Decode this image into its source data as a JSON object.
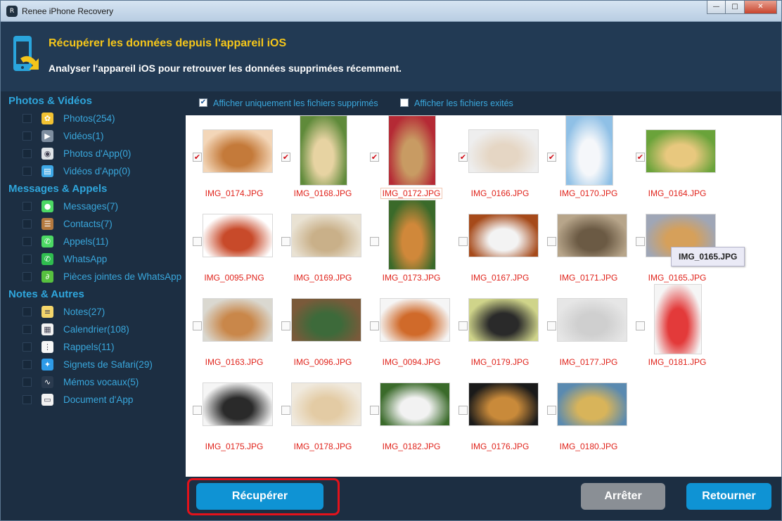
{
  "window": {
    "title": "Renee iPhone Recovery"
  },
  "header": {
    "title": "Récupérer les données depuis l'appareil iOS",
    "subtitle": "Analyser l'appareil iOS pour retrouver les données supprimées récemment."
  },
  "sidebar": {
    "categories": [
      {
        "title": "Photos & Vidéos",
        "items": [
          {
            "label": "Photos(254)",
            "icon": "sunflower-photo-icon",
            "color": "#f2c232"
          },
          {
            "label": "Vidéos(1)",
            "icon": "video-camera-icon",
            "color": "#7e8ea0"
          },
          {
            "label": "Photos d'App(0)",
            "icon": "camera-icon",
            "color": "#dfe4e8"
          },
          {
            "label": "Vidéos d'App(0)",
            "icon": "clapperboard-icon",
            "color": "#3ea8e6"
          }
        ]
      },
      {
        "title": "Messages & Appels",
        "items": [
          {
            "label": "Messages(7)",
            "icon": "message-bubble-icon",
            "color": "#4cd964"
          },
          {
            "label": "Contacts(7)",
            "icon": "contacts-book-icon",
            "color": "#b3793f"
          },
          {
            "label": "Appels(11)",
            "icon": "phone-icon",
            "color": "#4cd964"
          },
          {
            "label": "WhatsApp",
            "icon": "whatsapp-icon",
            "color": "#2fbd4f"
          },
          {
            "label": "Pièces jointes de WhatsApp",
            "icon": "paperclip-icon",
            "color": "#57c13f"
          }
        ]
      },
      {
        "title": "Notes & Autres",
        "items": [
          {
            "label": "Notes(27)",
            "icon": "notes-icon",
            "color": "#f4d66b"
          },
          {
            "label": "Calendrier(108)",
            "icon": "calendar-icon",
            "color": "#f2f2f2"
          },
          {
            "label": "Rappels(11)",
            "icon": "reminders-list-icon",
            "color": "#f7f7f7"
          },
          {
            "label": "Signets de Safari(29)",
            "icon": "safari-compass-icon",
            "color": "#2e9be8"
          },
          {
            "label": "Mémos vocaux(5)",
            "icon": "voice-wave-icon",
            "color": "#2a3a4e"
          },
          {
            "label": "Document d'App",
            "icon": "document-icon",
            "color": "#f2f2f2"
          }
        ]
      }
    ]
  },
  "filters": {
    "deleted_only": {
      "label": "Afficher uniquement les fichiers supprimés",
      "checked": true
    },
    "existing": {
      "label": "Afficher les fichiers exités",
      "checked": false
    }
  },
  "files": [
    {
      "name": "IMG_0174.JPG",
      "checked": true,
      "orient": "land",
      "colors": [
        "#f3d6b8",
        "#c47a3a"
      ]
    },
    {
      "name": "IMG_0168.JPG",
      "checked": true,
      "orient": "port",
      "colors": [
        "#5f8a3a",
        "#e7d3a2"
      ]
    },
    {
      "name": "IMG_0172.JPG",
      "checked": true,
      "orient": "port",
      "colors": [
        "#b52a35",
        "#c89b63"
      ]
    },
    {
      "name": "IMG_0166.JPG",
      "checked": true,
      "orient": "land",
      "colors": [
        "#eeeeee",
        "#e5d6c4"
      ]
    },
    {
      "name": "IMG_0170.JPG",
      "checked": true,
      "orient": "port",
      "colors": [
        "#8fc0e6",
        "#f5f7fa"
      ]
    },
    {
      "name": "IMG_0164.JPG",
      "checked": true,
      "orient": "land",
      "colors": [
        "#6aa33a",
        "#e8c87e"
      ]
    },
    {
      "name": "IMG_0095.PNG",
      "checked": false,
      "orient": "land",
      "colors": [
        "#ffffff",
        "#c84a2a"
      ]
    },
    {
      "name": "IMG_0169.JPG",
      "checked": false,
      "orient": "land",
      "colors": [
        "#e9e2d3",
        "#c9b089"
      ]
    },
    {
      "name": "IMG_0173.JPG",
      "checked": false,
      "orient": "port",
      "colors": [
        "#3a6a2a",
        "#d0883a"
      ]
    },
    {
      "name": "IMG_0167.JPG",
      "checked": false,
      "orient": "land",
      "colors": [
        "#a64a1a",
        "#f3f3f3"
      ]
    },
    {
      "name": "IMG_0171.JPG",
      "checked": false,
      "orient": "land",
      "colors": [
        "#b7a58a",
        "#6b5a44"
      ]
    },
    {
      "name": "IMG_0165.JPG",
      "checked": false,
      "orient": "land",
      "colors": [
        "#9fa6b6",
        "#d6a05a"
      ]
    },
    {
      "name": "IMG_0163.JPG",
      "checked": false,
      "orient": "land",
      "colors": [
        "#dad8d0",
        "#c9874a"
      ]
    },
    {
      "name": "IMG_0096.JPG",
      "checked": false,
      "orient": "land",
      "colors": [
        "#7a5a3a",
        "#3d6a3a"
      ]
    },
    {
      "name": "IMG_0094.JPG",
      "checked": false,
      "orient": "land",
      "colors": [
        "#f5f5f5",
        "#d06a2a"
      ]
    },
    {
      "name": "IMG_0179.JPG",
      "checked": false,
      "orient": "land",
      "colors": [
        "#cfd48a",
        "#2a2a2a"
      ]
    },
    {
      "name": "IMG_0177.JPG",
      "checked": false,
      "orient": "land",
      "colors": [
        "#e6e6e6",
        "#cfcfcf"
      ]
    },
    {
      "name": "IMG_0181.JPG",
      "checked": false,
      "orient": "port",
      "colors": [
        "#f5f5f5",
        "#e33a3a"
      ]
    },
    {
      "name": "IMG_0175.JPG",
      "checked": false,
      "orient": "land",
      "colors": [
        "#f5f5f5",
        "#2a2a2a"
      ]
    },
    {
      "name": "IMG_0178.JPG",
      "checked": false,
      "orient": "land",
      "colors": [
        "#f0eadf",
        "#e3cba4"
      ]
    },
    {
      "name": "IMG_0182.JPG",
      "checked": false,
      "orient": "land",
      "colors": [
        "#3a6a2a",
        "#f2f2f2"
      ]
    },
    {
      "name": "IMG_0176.JPG",
      "checked": false,
      "orient": "land",
      "colors": [
        "#1a1a1a",
        "#c98a3a"
      ]
    },
    {
      "name": "IMG_0180.JPG",
      "checked": false,
      "orient": "land",
      "colors": [
        "#5a8ab0",
        "#d8b45a"
      ]
    }
  ],
  "tooltip": "IMG_0165.JPG",
  "buttons": {
    "recover": "Récupérer",
    "stop": "Arrêter",
    "back": "Retourner"
  }
}
